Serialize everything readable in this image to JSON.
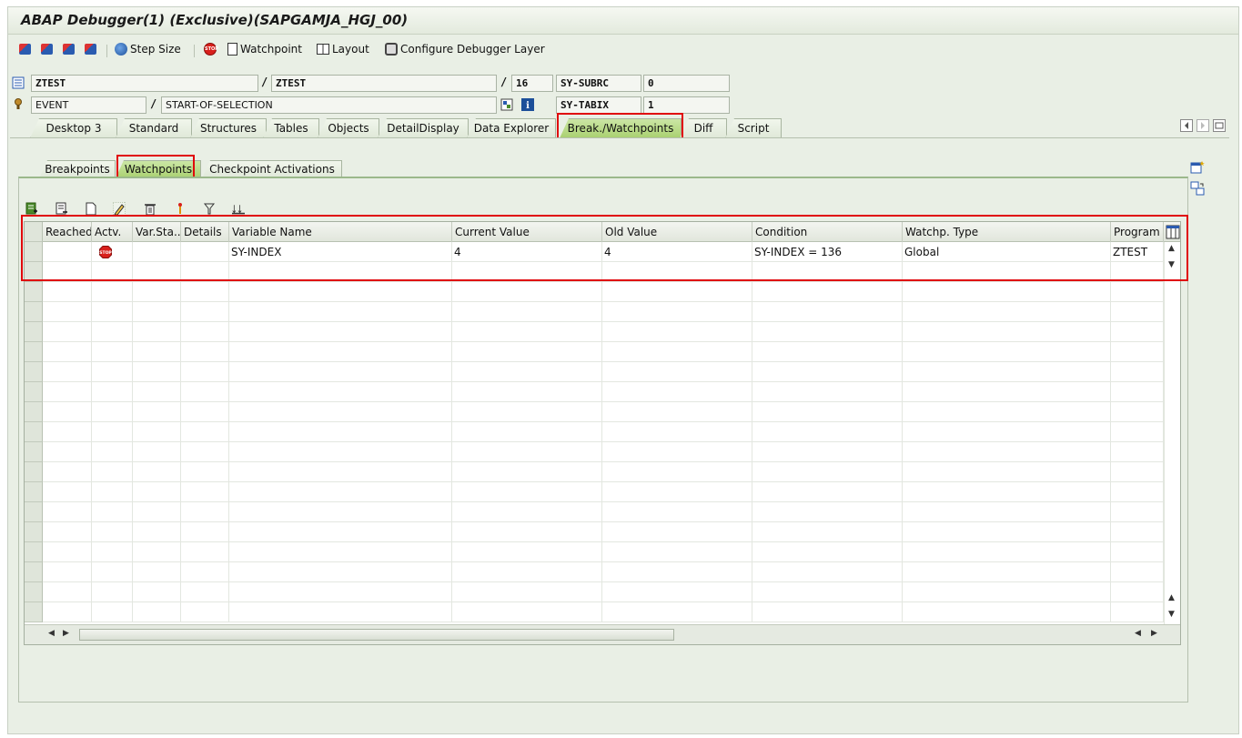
{
  "window": {
    "title": "ABAP Debugger(1)  (Exclusive)(SAPGAMJA_HGJ_00)"
  },
  "toolbar": {
    "step_size_label": "Step Size",
    "watchpoint_label": "Watchpoint",
    "layout_label": "Layout",
    "configure_label": "Configure Debugger Layer"
  },
  "context": {
    "program_1": "ZTEST",
    "program_2": "ZTEST",
    "line": "16",
    "sy_subrc_label": "SY-SUBRC",
    "sy_subrc_value": "0",
    "event_type": "EVENT",
    "event_name": "START-OF-SELECTION",
    "sy_tabix_label": "SY-TABIX",
    "sy_tabix_value": "1",
    "slash": "/"
  },
  "main_tabs": [
    {
      "label": "Desktop 3"
    },
    {
      "label": "Standard"
    },
    {
      "label": "Structures"
    },
    {
      "label": "Tables"
    },
    {
      "label": "Objects"
    },
    {
      "label": "DetailDisplay"
    },
    {
      "label": "Data Explorer"
    },
    {
      "label": "Break./Watchpoints"
    },
    {
      "label": "Diff"
    },
    {
      "label": "Script"
    }
  ],
  "sub_tabs": [
    {
      "label": "Breakpoints"
    },
    {
      "label": "Watchpoints"
    },
    {
      "label": "Checkpoint Activations"
    }
  ],
  "grid": {
    "columns": [
      "Reached",
      "Actv.",
      "Var.Sta...",
      "Details",
      "Variable Name",
      "Current Value",
      "Old Value",
      "Condition",
      "Watchp. Type",
      "Program"
    ],
    "rows": [
      {
        "reached": "",
        "actv_icon": "stop-icon",
        "var_sta": "",
        "details": "",
        "variable_name": "SY-INDEX",
        "current_value": "4",
        "old_value": "4",
        "condition": "SY-INDEX = 136",
        "watchp_type": "Global",
        "program": "ZTEST"
      }
    ]
  },
  "colors": {
    "highlight": "#e0060b",
    "active_tab": "#a9d06f",
    "background": "#e9efe5"
  }
}
